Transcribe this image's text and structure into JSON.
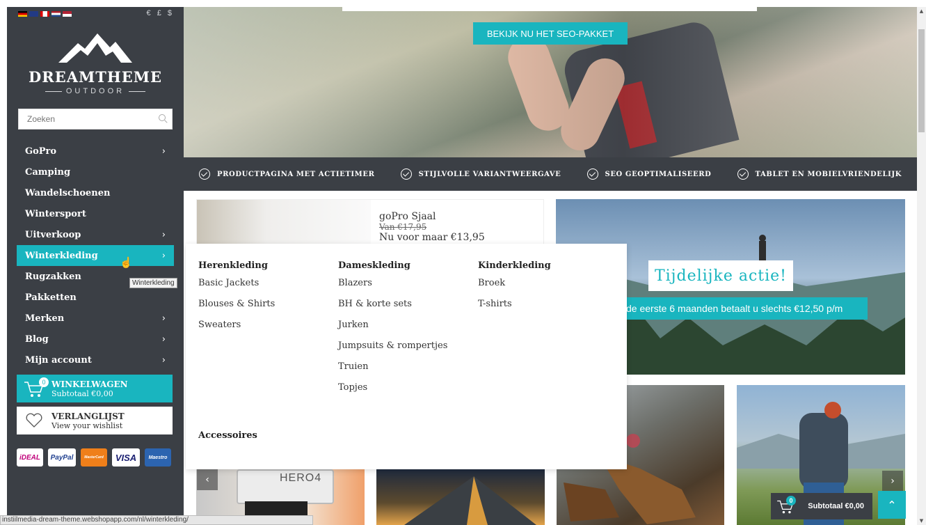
{
  "sidebar": {
    "currency": "€ £ $",
    "brand": {
      "title": "DREAMTHEME",
      "subtitle": "OUTDOOR"
    },
    "search_placeholder": "Zoeken",
    "menu": [
      {
        "label": "GoPro",
        "has_children": true
      },
      {
        "label": "Camping",
        "has_children": false
      },
      {
        "label": "Wandelschoenen",
        "has_children": false
      },
      {
        "label": "Wintersport",
        "has_children": false
      },
      {
        "label": "Uitverkoop",
        "has_children": true
      },
      {
        "label": "Winterkleding",
        "has_children": true,
        "active": true
      },
      {
        "label": "Rugzakken",
        "has_children": false
      },
      {
        "label": "Pakketten",
        "has_children": false
      },
      {
        "label": "Merken",
        "has_children": true
      },
      {
        "label": "Blog",
        "has_children": true
      },
      {
        "label": "Mijn account",
        "has_children": true
      }
    ],
    "tooltip": "Winterkleding",
    "cart": {
      "title": "WINKELWAGEN",
      "subtitle": "Subtotaal €0,00",
      "count": "0"
    },
    "wishlist": {
      "title": "VERLANGLIJST",
      "subtitle": "View your wishlist"
    },
    "payments": [
      "iDEAL",
      "PayPal",
      "MasterCard",
      "VISA",
      "Maestro"
    ]
  },
  "hero": {
    "button": "BEKIJK NU HET SEO-PAKKET"
  },
  "usp": [
    "PRODUCTPAGINA MET ACTIETIMER",
    "STIJLVOLLE VARIANTWEERGAVE",
    "SEO GEOPTIMALISEERD",
    "TABLET EN MOBIELVRIENDELIJK"
  ],
  "product": {
    "name": "goPro Sjaal",
    "old_price": "Van €17,95",
    "new_price": "Nu voor maar €13,95"
  },
  "promo": {
    "title": "Tijdelijke actie!",
    "text": "de eerste 6 maanden betaalt u slechts €12,50 p/m"
  },
  "mega_menu": {
    "columns": [
      {
        "heading": "Herenkleding",
        "items": [
          "Basic Jackets",
          "Blouses & Shirts",
          "Sweaters"
        ]
      },
      {
        "heading": "Dameskleding",
        "items": [
          "Blazers",
          "BH & korte sets",
          "Jurken",
          "Jumpsuits & rompertjes",
          "Truien",
          "Topjes"
        ]
      },
      {
        "heading": "Kinderkleding",
        "items": [
          "Broek",
          "T-shirts"
        ]
      }
    ],
    "extra": "Accessoires"
  },
  "tiles": {
    "gopro_text": "HERO4"
  },
  "floating_cart": {
    "label": "Subtotaal €0,00",
    "count": "0"
  },
  "status_url": "instiilmedia-dream-theme.webshopapp.com/nl/winterkleding/",
  "colors": {
    "accent": "#19b5bf",
    "dark": "#3b3f45"
  }
}
